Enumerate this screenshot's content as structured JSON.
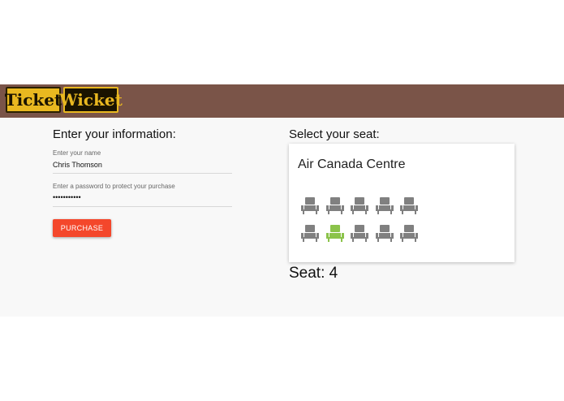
{
  "brand": {
    "logo_ticket": "Ticket",
    "logo_wicket": "Wicket"
  },
  "info_form": {
    "heading": "Enter your information:",
    "name_label": "Enter your name",
    "name_value": "Chris Thomson",
    "password_label": "Enter a password to protect your purchase",
    "password_value": "•••••••••••",
    "purchase_label": "PURCHASE"
  },
  "seat_picker": {
    "heading": "Select your seat:",
    "venue": "Air Canada Centre",
    "seats": [
      {
        "number": 1,
        "selected": false
      },
      {
        "number": 2,
        "selected": false
      },
      {
        "number": 3,
        "selected": false
      },
      {
        "number": 4,
        "selected": false
      },
      {
        "number": 5,
        "selected": false
      },
      {
        "number": 6,
        "selected": false
      },
      {
        "number": 7,
        "selected": true
      },
      {
        "number": 8,
        "selected": false
      },
      {
        "number": 9,
        "selected": false
      },
      {
        "number": 10,
        "selected": false
      }
    ],
    "seat_icon": "armchair-icon",
    "seat_color": "#808080",
    "selected_color": "#8bc34a",
    "readout": "Seat: 4"
  },
  "colors": {
    "header": "#7a5448",
    "accent": "#f4472b",
    "logo_gold": "#e9b820"
  }
}
